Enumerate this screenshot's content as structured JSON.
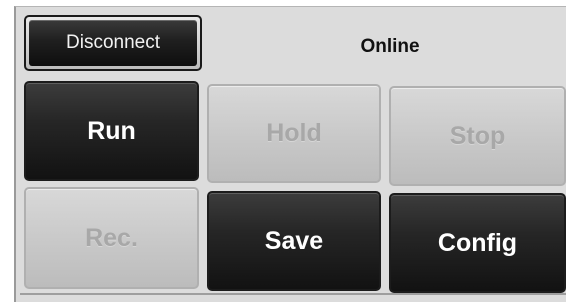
{
  "toolbar": {
    "disconnect_label": "Disconnect",
    "status_text": "Online"
  },
  "buttons": {
    "run": {
      "label": "Run",
      "enabled": true
    },
    "hold": {
      "label": "Hold",
      "enabled": false
    },
    "stop": {
      "label": "Stop",
      "enabled": false
    },
    "rec": {
      "label": "Rec.",
      "enabled": false
    },
    "save": {
      "label": "Save",
      "enabled": true
    },
    "config": {
      "label": "Config",
      "enabled": true
    }
  }
}
